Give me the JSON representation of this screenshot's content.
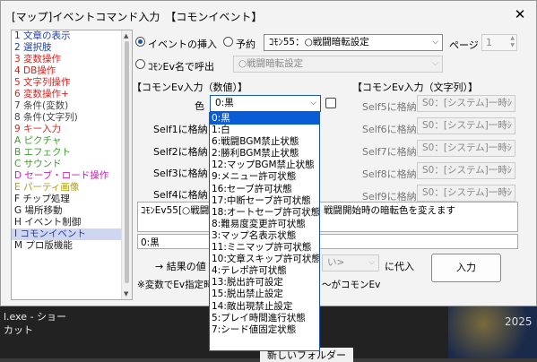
{
  "window": {
    "title": "[マップ]イベントコマンド入力　【コモンイベント】",
    "close": "✕"
  },
  "sidebar": {
    "items": [
      {
        "label": "1 文章の表示",
        "color": "#1e3fa6"
      },
      {
        "label": "2 選択肢",
        "color": "#1e3fa6"
      },
      {
        "label": "3 変数操作",
        "color": "#e0201c"
      },
      {
        "label": "4 DB操作",
        "color": "#e0201c"
      },
      {
        "label": "5 文字列操作",
        "color": "#e0201c"
      },
      {
        "label": "6 変数操作+",
        "color": "#e0201c"
      },
      {
        "label": "7 条件(変数)",
        "color": "#444444"
      },
      {
        "label": "8 条件(文字列)",
        "color": "#444444"
      },
      {
        "label": "9 キー入力",
        "color": "#e0201c"
      },
      {
        "label": "A ピクチャ",
        "color": "#3e9a2e"
      },
      {
        "label": "B エフェクト",
        "color": "#3e9a2e"
      },
      {
        "label": "C サウンド",
        "color": "#3e9a2e"
      },
      {
        "label": "D セーブ・ロード操作",
        "color": "#c71fb0"
      },
      {
        "label": "E パーティ画像",
        "color": "#a8a020"
      },
      {
        "label": "F チップ処理",
        "color": "#222222"
      },
      {
        "label": "G 場所移動",
        "color": "#222222"
      },
      {
        "label": "H イベント制御",
        "color": "#222222"
      },
      {
        "label": "I コモンイベント",
        "color": "#1e3fa6",
        "selected": true
      },
      {
        "label": "M プロ版機能",
        "color": "#222222"
      }
    ]
  },
  "insert": {
    "event_insert_label": "イベントの挿入",
    "reserve_label": "予約",
    "common_select": "ｺﾓﾝ55：○戦闘暗転設定",
    "page_label": "ページ",
    "page_value": "1",
    "call_by_name_label": "ｺﾓﾝEv名で呼出",
    "call_by_name_value": "○戦闘暗転設定"
  },
  "numeric": {
    "header": "【コモンEv入力（数値）】",
    "color_label": "色",
    "color_value": "0:黒",
    "slots": [
      "Self1に格納",
      "Self2に格納",
      "Self3に格納",
      "Self4に格納"
    ]
  },
  "string": {
    "header": "【コモンEv入力（文字列）】",
    "slots": [
      {
        "label": "Self5に格納",
        "value": "S0：[システム]一時ｼ"
      },
      {
        "label": "Self6に格納",
        "value": "S0：[システム]一時ｼ"
      },
      {
        "label": "Self7に格納",
        "value": "S0：[システム]一時ｼ"
      },
      {
        "label": "Self8に格納",
        "value": "S0：[システム]一時ｼ"
      },
      {
        "label": "Self9に格納",
        "value": "S0：[システム]一時ｼ"
      }
    ]
  },
  "description": {
    "line1_left": "ｺﾓﾝEv55[○戦闘",
    "line1_right": "戦闘開始時の暗転色を変えます",
    "value": "0:黒"
  },
  "result": {
    "label": "→ 結果の値",
    "select_value": "い>",
    "assign_label": "に代入",
    "note_left": "※変数でEv指定時",
    "note_right": "～がコモンEv"
  },
  "buttons": {
    "input_label": "入力"
  },
  "dropdown": {
    "options": [
      "0:黒",
      "1:白",
      "6:戦闘BGM禁止状態",
      "2:勝利BGM禁止状態",
      "12:マップBGM禁止状態",
      "9:メニュー許可状態",
      "16:セーブ許可状態",
      "17:中断セーブ許可状態",
      "18:オートセーブ許可状態",
      "8:難易度変更許可状態",
      "3:マップ名表示状態",
      "11:ミニマップ許可状態",
      "10:文章スキップ許可状態",
      "4:テレポ許可状態",
      "13:脱出許可設定",
      "15:脱出禁止設定",
      "14:敵出現禁止設定",
      "5:プレイ時間進行状態",
      "7:シード値固定状態"
    ],
    "selected_index": 0
  },
  "desktop": {
    "exe_text": "l.exe - ショー",
    "cut_text": "カット",
    "folder_text": "新しいフォルダー",
    "year_text": "2025"
  }
}
